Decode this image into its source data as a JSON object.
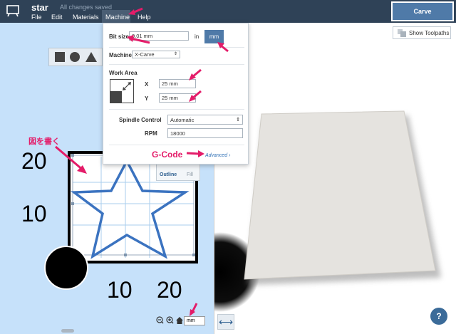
{
  "header": {
    "title": "star",
    "save_status": "All changes saved",
    "menus": [
      "File",
      "Edit",
      "Materials",
      "Machine",
      "Help"
    ],
    "carve_label": "Carve"
  },
  "machine_panel": {
    "bit_size_label": "Bit size",
    "bit_size_value": "0.01 mm",
    "unit_in": "in",
    "unit_mm": "mm",
    "machine_label": "Machine",
    "machine_value": "X-Carve",
    "work_area_label": "Work Area",
    "x_label": "X",
    "x_value": "25 mm",
    "y_label": "Y",
    "y_value": "25 mm",
    "spindle_label": "Spindle Control",
    "spindle_value": "Automatic",
    "rpm_label": "RPM",
    "rpm_value": "18000",
    "advanced_link": "Advanced",
    "gcode_annotation": "G-Code"
  },
  "canvas": {
    "annotation_draw": "図を書く",
    "label_20_y": "20",
    "label_10_y": "10",
    "label_10_x": "10",
    "label_20_x": "20",
    "outline_label": "Outline",
    "fill_label": "Fill",
    "zoom_unit": "mm"
  },
  "preview": {
    "show_toolpaths_label": "Show Toolpaths",
    "help_label": "?"
  },
  "colors": {
    "header_bg": "#2f4257",
    "accent": "#4f7aa8",
    "annotation": "#e41c69",
    "canvas_bg": "#c6e1fa",
    "star_stroke": "#3b73c0"
  }
}
